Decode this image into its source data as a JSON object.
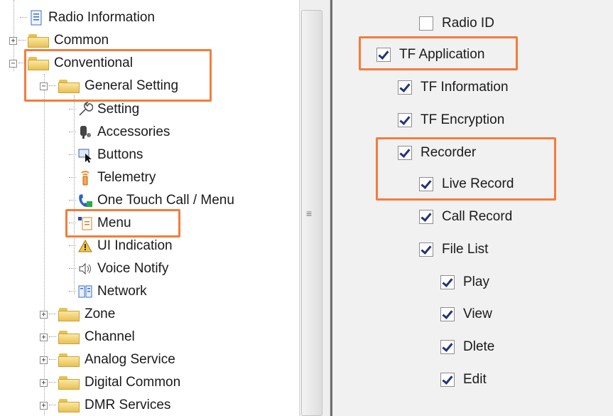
{
  "tree": {
    "items": [
      {
        "label": "Radio Information",
        "icon": "radio-information-icon",
        "expander": ""
      },
      {
        "label": "Common",
        "icon": "folder-icon",
        "expander": "+"
      },
      {
        "label": "Conventional",
        "icon": "folder-icon",
        "expander": "−"
      },
      {
        "label": "General Setting",
        "icon": "folder-open-icon",
        "expander": "−"
      },
      {
        "label": "Setting",
        "icon": "wrench-icon"
      },
      {
        "label": "Accessories",
        "icon": "accessories-icon"
      },
      {
        "label": "Buttons",
        "icon": "buttons-cursor-icon"
      },
      {
        "label": "Telemetry",
        "icon": "telemetry-icon"
      },
      {
        "label": "One Touch Call / Menu",
        "icon": "phone-call-icon"
      },
      {
        "label": "Menu",
        "icon": "menu-icon"
      },
      {
        "label": "UI Indication",
        "icon": "ui-indication-icon"
      },
      {
        "label": "Voice Notify",
        "icon": "speaker-icon"
      },
      {
        "label": "Network",
        "icon": "network-icon"
      },
      {
        "label": "Zone",
        "icon": "folder-icon",
        "expander": "+"
      },
      {
        "label": "Channel",
        "icon": "folder-icon",
        "expander": "+"
      },
      {
        "label": "Analog Service",
        "icon": "folder-icon",
        "expander": "+"
      },
      {
        "label": "Digital Common",
        "icon": "folder-icon",
        "expander": "+"
      },
      {
        "label": "DMR Services",
        "icon": "folder-icon",
        "expander": "+"
      }
    ],
    "highlighted": [
      "Conventional",
      "General Setting",
      "Menu"
    ]
  },
  "splitter": {
    "grip": "≡"
  },
  "menu_options": [
    {
      "label": "Radio ID",
      "checked": false
    },
    {
      "label": "TF Application",
      "checked": true
    },
    {
      "label": "TF Information",
      "checked": true
    },
    {
      "label": "TF Encryption",
      "checked": true
    },
    {
      "label": "Recorder",
      "checked": true
    },
    {
      "label": "Live Record",
      "checked": true
    },
    {
      "label": "Call Record",
      "checked": true
    },
    {
      "label": "File List",
      "checked": true
    },
    {
      "label": "Play",
      "checked": true
    },
    {
      "label": "View",
      "checked": true
    },
    {
      "label": "Dlete",
      "checked": true
    },
    {
      "label": "Edit",
      "checked": true
    }
  ],
  "colors": {
    "highlight": "#f47c3c",
    "check": "#22327a",
    "panel_bg": "#f1f1f1"
  }
}
